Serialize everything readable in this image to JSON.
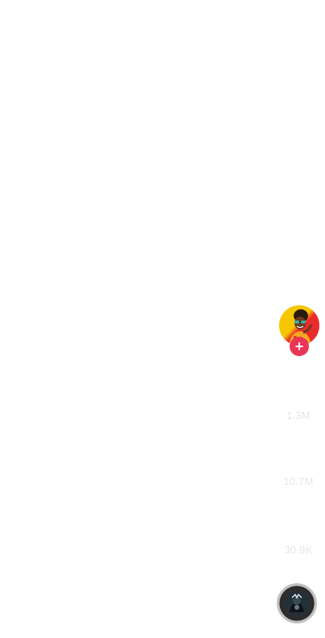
{
  "action_rail": {
    "creator_avatar": "creator-avatar-photo",
    "follow_icon": "plus-icon",
    "follow_symbol": "+",
    "likes_count": "1.3M",
    "comments_count": "10.7M",
    "shares_count": "30.9K",
    "music_disc": "spinning-music-disc"
  },
  "colors": {
    "follow_badge": "#ea3556",
    "avatar_yellow": "#f7c600",
    "avatar_red": "#ea2b2b",
    "count_text": "#e6e6e6"
  }
}
